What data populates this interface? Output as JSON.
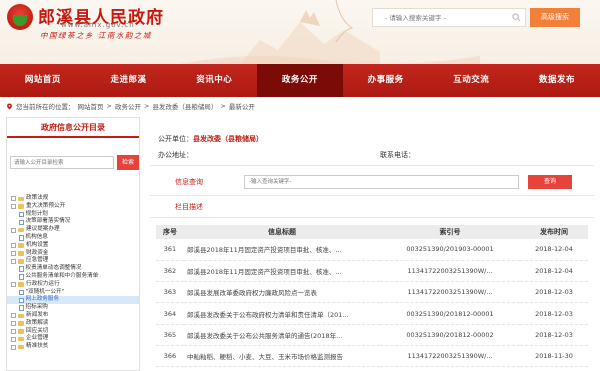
{
  "header": {
    "title": "郎溪县人民政府",
    "domain": "www.ahlx.gov.cn",
    "slogan": "中国绿茶之乡 江南水韵之城",
    "search_placeholder": "- 请输入搜索关键字 -",
    "advanced_search_label": "高级搜索",
    "brand_color": "#c81812"
  },
  "nav": {
    "items": [
      {
        "label": "网站首页",
        "active": false
      },
      {
        "label": "走进郎溪",
        "active": false
      },
      {
        "label": "资讯中心",
        "active": false
      },
      {
        "label": "政务公开",
        "active": true
      },
      {
        "label": "办事服务",
        "active": false
      },
      {
        "label": "互动交流",
        "active": false
      },
      {
        "label": "数据发布",
        "active": false
      }
    ]
  },
  "breadcrumb": {
    "prefix": "您当前所在的位置：",
    "parts": [
      "网站首页",
      "政务公开",
      "县发改委（县粮储局）",
      "最新公开"
    ],
    "separator": ">"
  },
  "sidebar": {
    "title": "政府信息公开目录",
    "search_placeholder": "请输入公开目录检索",
    "search_button": "检索",
    "tree": [
      {
        "label": "政策法规",
        "type": "folder",
        "toggle": "+"
      },
      {
        "label": "重大决策预公开",
        "type": "folder",
        "toggle": "-"
      },
      {
        "label": "规划计划",
        "type": "doc",
        "toggle": ""
      },
      {
        "label": "决策部署落实情况",
        "type": "doc",
        "toggle": ""
      },
      {
        "label": "建议提案办理",
        "type": "folder",
        "toggle": "+"
      },
      {
        "label": "机构信息",
        "type": "doc",
        "toggle": ""
      },
      {
        "label": "机构设置",
        "type": "folder",
        "toggle": "+"
      },
      {
        "label": "财政资金",
        "type": "folder",
        "toggle": "+"
      },
      {
        "label": "应急管理",
        "type": "folder",
        "toggle": "-"
      },
      {
        "label": "权责清单动态调整情况",
        "type": "doc",
        "toggle": ""
      },
      {
        "label": "公共服务清单和中介服务清单",
        "type": "doc",
        "toggle": ""
      },
      {
        "label": "行政权力运行",
        "type": "folder",
        "toggle": "-"
      },
      {
        "label": "\"双随机一公开\"",
        "type": "doc",
        "toggle": ""
      },
      {
        "label": "网上政务服务",
        "type": "doc",
        "toggle": "",
        "highlight": true
      },
      {
        "label": "招标采购",
        "type": "doc",
        "toggle": ""
      },
      {
        "label": "新闻发布",
        "type": "folder",
        "toggle": "+"
      },
      {
        "label": "政策解读",
        "type": "folder",
        "toggle": "+"
      },
      {
        "label": "回应关切",
        "type": "folder",
        "toggle": "+"
      },
      {
        "label": "企业管理",
        "type": "folder",
        "toggle": "+"
      },
      {
        "label": "精准扶贫",
        "type": "folder",
        "toggle": "+"
      }
    ]
  },
  "main": {
    "unit_label": "公开单位：",
    "unit_value": "县发改委（县粮储局）",
    "office_label": "办公地址：",
    "office_value": "",
    "phone_label": "联系电话：",
    "phone_value": "",
    "query_label": "信息查询",
    "query_placeholder": "-输入查询关键字-",
    "query_button": "查询",
    "column_label": "栏目描述",
    "table": {
      "headers": [
        "序号",
        "信息标题",
        "索引号",
        "发布时间"
      ],
      "rows": [
        [
          "361",
          "郎溪县2018年11月固定资产投资项目审批、核准、...",
          "003251390/201903-00001",
          "2018-12-04"
        ],
        [
          "362",
          "郎溪县2018年11月固定资产投资项目审批、核准、...",
          "11341722003251390W/...",
          "2018-12-04"
        ],
        [
          "363",
          "郎溪县发展改革委政府权力廉政风险点一览表",
          "11341722003251390W/...",
          "2018-12-03"
        ],
        [
          "364",
          "郎溪县发改委关于公布政府权力清单和责任清单（201...",
          "003251390/201812-00001",
          "2018-12-03"
        ],
        [
          "365",
          "郎溪县发改委关于公布公共服务清单的通告(2018年...",
          "003251390/201812-00002",
          "2018-12-03"
        ],
        [
          "366",
          "中籼籼稻、粳稻、小麦、大豆、玉米市场价格监测报告",
          "11341722003251390W/...",
          "2018-11-30"
        ]
      ]
    }
  }
}
